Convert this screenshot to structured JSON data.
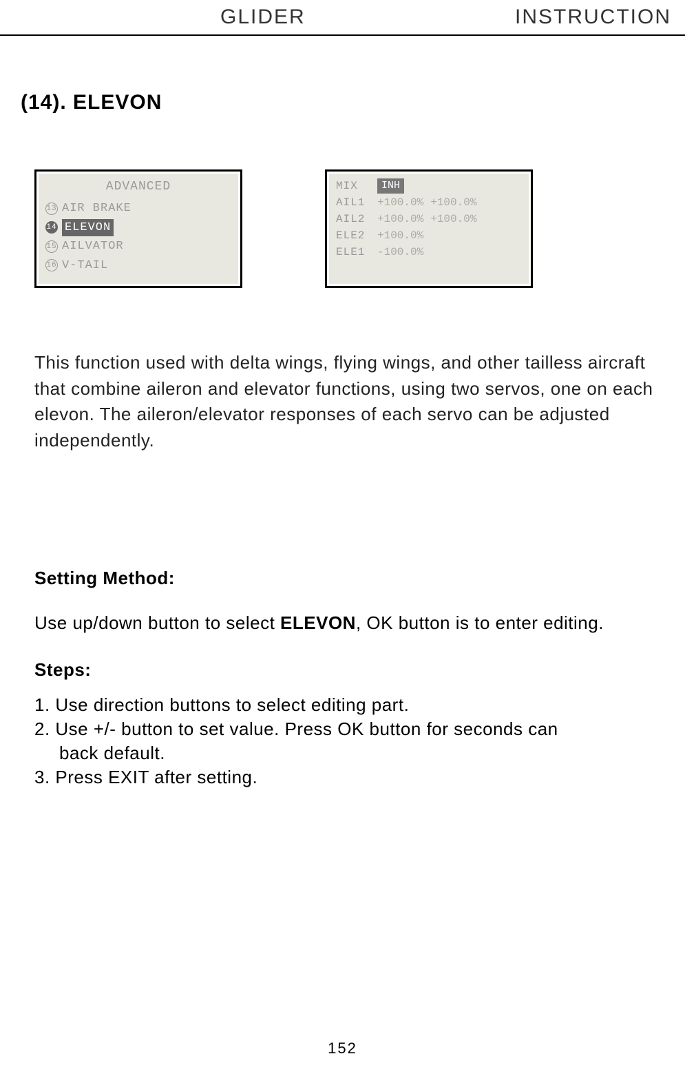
{
  "header": {
    "left": "GLIDER",
    "right": "INSTRUCTION"
  },
  "section_title": "(14). ELEVON",
  "screen1": {
    "title": "ADVANCED",
    "items": [
      {
        "num": "13",
        "label": "AIR BRAKE",
        "selected": false
      },
      {
        "num": "14",
        "label": "ELEVON",
        "selected": true
      },
      {
        "num": "15",
        "label": "AILVATOR",
        "selected": false
      },
      {
        "num": "16",
        "label": "V-TAIL",
        "selected": false
      }
    ]
  },
  "screen2": {
    "mix_label": "MIX",
    "mix_value": "INH",
    "rows": [
      {
        "label": "AIL1",
        "v1": "+100.0%",
        "v2": "+100.0%"
      },
      {
        "label": "AIL2",
        "v1": "+100.0%",
        "v2": "+100.0%"
      },
      {
        "label": "ELE2",
        "v1": "+100.0%",
        "v2": ""
      },
      {
        "label": "ELE1",
        "v1": "-100.0%",
        "v2": ""
      }
    ]
  },
  "description": "This function used with delta wings, flying wings, and other tailless aircraft that combine aileron and elevator functions, using two servos, one on each elevon. The aileron/elevator responses of each servo can be adjusted independently.",
  "setting": {
    "heading": "Setting Method:",
    "intro_pre": "Use up/down button to select ",
    "intro_bold": "ELEVON",
    "intro_post": ", OK button is to enter editing.",
    "steps_heading": "Steps:",
    "steps": [
      "1. Use direction buttons to select editing part.",
      "2. Use +/- button to set value. Press OK button for seconds can",
      "    back default.",
      "3. Press EXIT after setting."
    ]
  },
  "page_number": "152"
}
